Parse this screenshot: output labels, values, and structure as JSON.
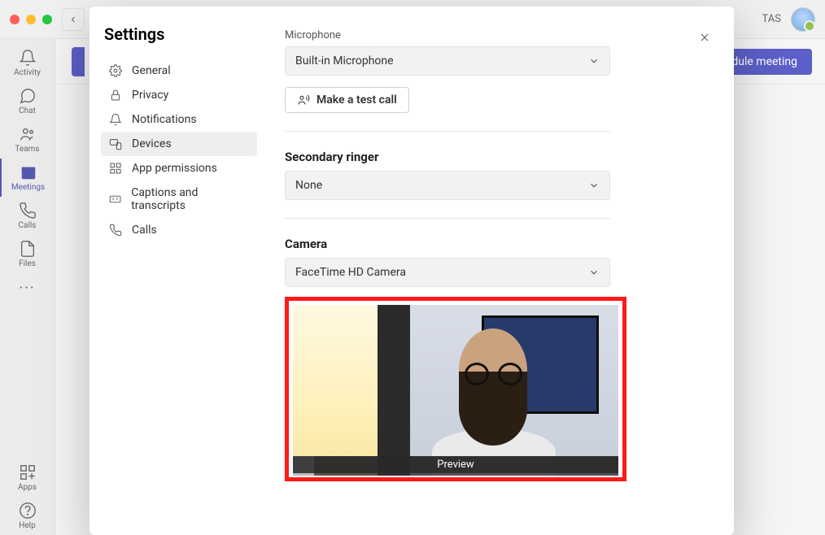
{
  "titlebar": {
    "user_initials": "TAS"
  },
  "sidebar": {
    "items": [
      {
        "label": "Activity"
      },
      {
        "label": "Chat"
      },
      {
        "label": "Teams"
      },
      {
        "label": "Meetings"
      },
      {
        "label": "Calls"
      },
      {
        "label": "Files"
      }
    ],
    "apps": "Apps",
    "help": "Help"
  },
  "main": {
    "schedule_button": "dule meeting"
  },
  "settings": {
    "title": "Settings",
    "nav": [
      {
        "label": "General"
      },
      {
        "label": "Privacy"
      },
      {
        "label": "Notifications"
      },
      {
        "label": "Devices"
      },
      {
        "label": "App permissions"
      },
      {
        "label": "Captions and transcripts"
      },
      {
        "label": "Calls"
      }
    ],
    "microphone": {
      "label": "Microphone",
      "value": "Built-in Microphone",
      "test_call": "Make a test call"
    },
    "secondary_ringer": {
      "heading": "Secondary ringer",
      "value": "None"
    },
    "camera": {
      "heading": "Camera",
      "value": "FaceTime HD Camera",
      "preview_caption": "Preview"
    }
  }
}
